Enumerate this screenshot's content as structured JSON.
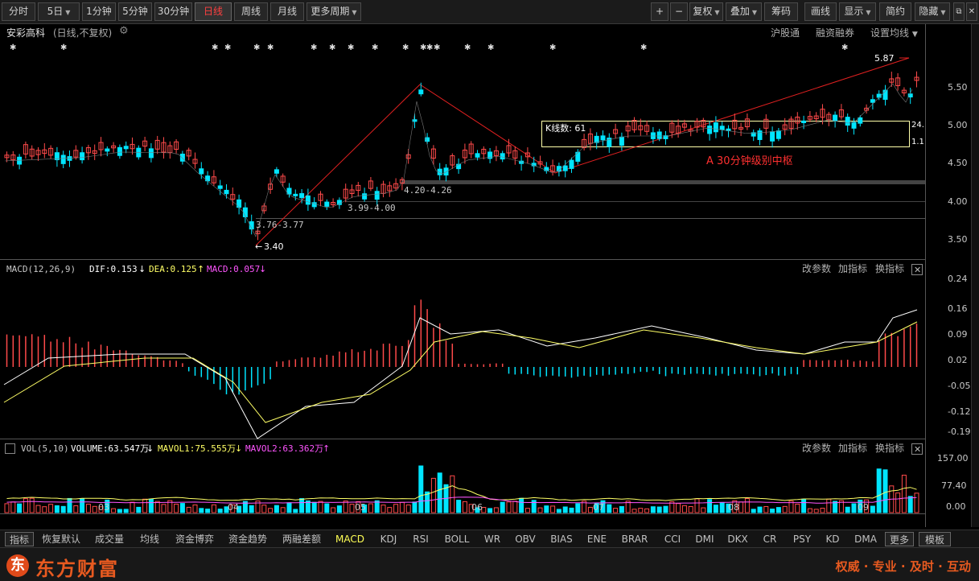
{
  "toolbar": {
    "left": [
      "分时",
      "5日",
      "1分钟",
      "5分钟",
      "30分钟",
      "日线",
      "周线",
      "月线",
      "更多周期"
    ],
    "active": "日线",
    "right": [
      "+",
      "−",
      "复权",
      "叠加",
      "筹码",
      "画线",
      "显示",
      "简约",
      "隐藏"
    ],
    "window_icon": "restore-window-icon",
    "close_icon": "close-icon"
  },
  "stock": {
    "name": "安彩高科",
    "mode": "(日线,不复权)"
  },
  "title_links": [
    "沪股通",
    "融资融券",
    "设置均线"
  ],
  "kline": {
    "price_ticks": [
      "5.50",
      "5.00",
      "4.50",
      "4.00",
      "3.50"
    ],
    "annotations": {
      "high": "5.87",
      "low": "3.40",
      "low_arrow": "←",
      "gap1": "3.76-3.77",
      "gap2": "3.99-4.00",
      "gap3": "4.20-4.26",
      "box_label": "K线数: 61",
      "zone_label": "A  30分钟级别中枢",
      "edge_val1": "24.",
      "edge_val2": "1.1"
    }
  },
  "macd": {
    "label": "MACD(12,26,9)",
    "dif": "DIF:0.153",
    "dea": "DEA:0.125",
    "macd": "MACD:0.057",
    "dif_arrow": "↓",
    "dea_arrow": "↑",
    "macd_arrow": "↓",
    "ticks": [
      "0.24",
      "0.16",
      "0.09",
      "0.02",
      "-0.05",
      "-0.12",
      "-0.19"
    ],
    "links": [
      "改参数",
      "加指标",
      "换指标"
    ]
  },
  "vol": {
    "label": "VOL(5,10)",
    "volume": "VOLUME:63.547万",
    "mavol1": "MAVOL1:75.555万",
    "mavol2": "MAVOL2:63.362万",
    "volume_arrow": "↓",
    "mavol1_arrow": "↓",
    "mavol2_arrow": "↑",
    "ticks": [
      "157.00",
      "77.40",
      "0.00"
    ],
    "links": [
      "改参数",
      "加指标",
      "换指标"
    ]
  },
  "months": [
    "03",
    "04",
    "05",
    "06",
    "07",
    "08",
    "09"
  ],
  "tabs": [
    "指标",
    "恢复默认",
    "成交量",
    "均线",
    "资金博弈",
    "资金趋势",
    "两融差额",
    "MACD",
    "KDJ",
    "RSI",
    "BOLL",
    "WR",
    "OBV",
    "BIAS",
    "ENE",
    "BRAR",
    "CCI",
    "DMI",
    "DKX",
    "CR",
    "PSY",
    "KD",
    "DMA",
    "更多",
    "模板"
  ],
  "tab_selected": "MACD",
  "footer": {
    "logo": "东",
    "brand": "东方财富",
    "slogan": "权威 · 专业 · 及时 · 互动"
  },
  "colors": {
    "up": "#ff4a4a",
    "down": "#00e5ff",
    "ma1": "#ffffff",
    "ma2": "#ffff66",
    "accent": "#ff3030"
  }
}
